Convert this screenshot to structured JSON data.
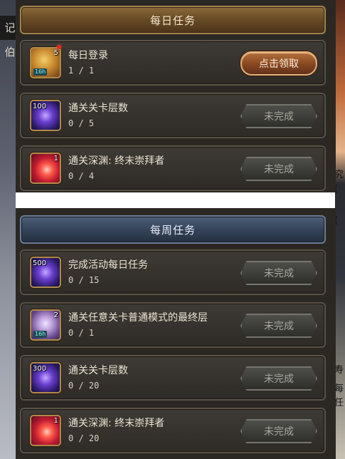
{
  "background": {
    "left_caption": "记伯",
    "right_text": [
      "究",
      "(",
      "(",
      "寿",
      "每",
      "任"
    ]
  },
  "daily": {
    "title": "每日任务",
    "tasks": [
      {
        "name": "每日登录",
        "progress": "1 / 1",
        "button": "点击领取",
        "state": "claim",
        "icon": "chest-icon",
        "count": "5",
        "tag": "16h",
        "dot": true
      },
      {
        "name": "通关关卡层数",
        "progress": "0 / 5",
        "button": "未完成",
        "state": "pending",
        "icon": "purple-crystal-icon",
        "count": "100"
      },
      {
        "name": "通关深渊: 终末崇拜者",
        "progress": "0 / 4",
        "button": "未完成",
        "state": "pending",
        "icon": "red-orb-icon",
        "count": "1"
      }
    ]
  },
  "weekly": {
    "title": "每周任务",
    "tasks": [
      {
        "name": "完成活动每日任务",
        "progress": "0 / 15",
        "button": "未完成",
        "state": "pending",
        "icon": "purple-crystal-icon",
        "count": "500"
      },
      {
        "name": "通关任意关卡普通模式的最终层",
        "progress": "0 / 1",
        "button": "未完成",
        "state": "pending",
        "icon": "lilac-gem-icon",
        "count": "2",
        "tag": "16h"
      },
      {
        "name": "通关关卡层数",
        "progress": "0 / 20",
        "button": "未完成",
        "state": "pending",
        "icon": "purple-crystal-icon",
        "count": "300"
      },
      {
        "name": "通关深渊: 终末崇拜者",
        "progress": "0 / 20",
        "button": "未完成",
        "state": "pending",
        "icon": "red-orb-icon",
        "count": "1"
      }
    ]
  },
  "colors": {
    "daily_header": "#6a4c26",
    "weekly_header": "#34445a",
    "claim_button": "#8a4a22",
    "pending_button": "#3e3e3a"
  }
}
